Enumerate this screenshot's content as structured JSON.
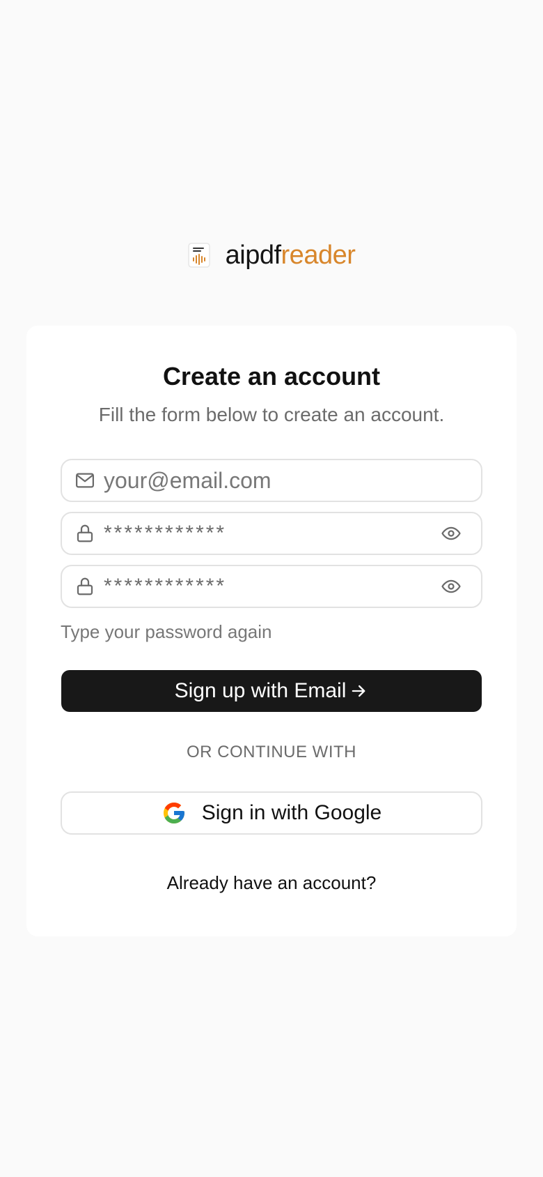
{
  "brand": {
    "name_part1": "aipdf",
    "name_part2": "reader",
    "logo_icon": "document-audio-icon",
    "accent_color": "#d8862b"
  },
  "form": {
    "title": "Create an account",
    "subtitle": "Fill the form below to create an account.",
    "email": {
      "placeholder": "your@email.com",
      "icon": "mail-icon"
    },
    "password": {
      "value": "************",
      "icon": "lock-icon",
      "toggle_icon": "eye-icon"
    },
    "confirm_password": {
      "value": "************",
      "icon": "lock-icon",
      "toggle_icon": "eye-icon"
    },
    "confirm_hint": "Type your password again",
    "submit_label": "Sign up with Email",
    "submit_icon": "arrow-right-icon",
    "divider": "OR CONTINUE WITH",
    "google_label": "Sign in with Google",
    "google_icon": "google-icon",
    "signin_link": "Already have an account?"
  },
  "colors": {
    "primary_button": "#181818",
    "background": "#fafafa",
    "card": "#ffffff"
  }
}
